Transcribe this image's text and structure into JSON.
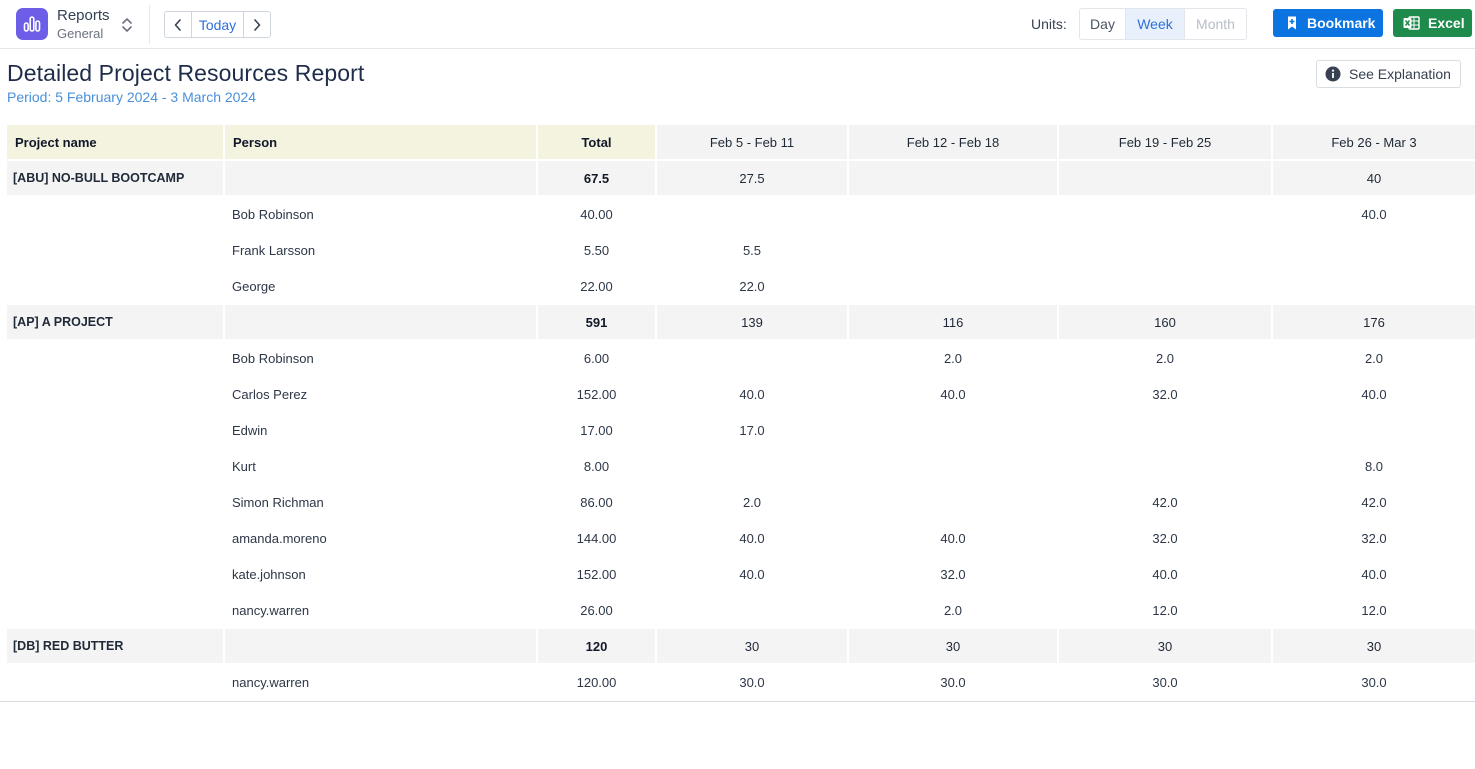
{
  "app": {
    "title": "Reports",
    "subtitle": "General"
  },
  "nav": {
    "today_label": "Today"
  },
  "units": {
    "label": "Units:",
    "options": [
      "Day",
      "Week",
      "Month"
    ],
    "selected": "Week"
  },
  "actions": {
    "bookmark_label": "Bookmark",
    "excel_label": "Excel",
    "explain_label": "See Explanation"
  },
  "colors": {
    "app_icon": "#6d5ee8",
    "bookmark": "#0b74e0",
    "excel": "#1e8a4c",
    "link": "#2f6fdb",
    "period": "#4a90d9"
  },
  "report": {
    "title": "Detailed Project Resources Report",
    "period": "Period: 5 February 2024 - 3 March 2024"
  },
  "table": {
    "columns": [
      "Project name",
      "Person",
      "Total",
      "Feb 5 - Feb 11",
      "Feb 12 - Feb 18",
      "Feb 19 - Feb 25",
      "Feb 26 - Mar 3"
    ],
    "projects": [
      {
        "name": "[ABU] NO-BULL BOOTCAMP",
        "total": "67.5",
        "weeks": [
          "27.5",
          "",
          "",
          "40"
        ],
        "people": [
          {
            "person": "Bob Robinson",
            "total": "40.00",
            "weeks": [
              "",
              "",
              "",
              "40.0"
            ]
          },
          {
            "person": "Frank Larsson",
            "total": "5.50",
            "weeks": [
              "5.5",
              "",
              "",
              ""
            ]
          },
          {
            "person": "George",
            "total": "22.00",
            "weeks": [
              "22.0",
              "",
              "",
              ""
            ]
          }
        ]
      },
      {
        "name": "[AP] A PROJECT",
        "total": "591",
        "weeks": [
          "139",
          "116",
          "160",
          "176"
        ],
        "people": [
          {
            "person": "Bob Robinson",
            "total": "6.00",
            "weeks": [
              "",
              "2.0",
              "2.0",
              "2.0"
            ]
          },
          {
            "person": "Carlos Perez",
            "total": "152.00",
            "weeks": [
              "40.0",
              "40.0",
              "32.0",
              "40.0"
            ]
          },
          {
            "person": "Edwin",
            "total": "17.00",
            "weeks": [
              "17.0",
              "",
              "",
              ""
            ]
          },
          {
            "person": "Kurt",
            "total": "8.00",
            "weeks": [
              "",
              "",
              "",
              "8.0"
            ]
          },
          {
            "person": "Simon Richman",
            "total": "86.00",
            "weeks": [
              "2.0",
              "",
              "42.0",
              "42.0"
            ]
          },
          {
            "person": "amanda.moreno",
            "total": "144.00",
            "weeks": [
              "40.0",
              "40.0",
              "32.0",
              "32.0"
            ]
          },
          {
            "person": "kate.johnson",
            "total": "152.00",
            "weeks": [
              "40.0",
              "32.0",
              "40.0",
              "40.0"
            ]
          },
          {
            "person": "nancy.warren",
            "total": "26.00",
            "weeks": [
              "",
              "2.0",
              "12.0",
              "12.0"
            ]
          }
        ]
      },
      {
        "name": "[DB] RED BUTTER",
        "total": "120",
        "weeks": [
          "30",
          "30",
          "30",
          "30"
        ],
        "people": [
          {
            "person": "nancy.warren",
            "total": "120.00",
            "weeks": [
              "30.0",
              "30.0",
              "30.0",
              "30.0"
            ]
          }
        ]
      }
    ]
  }
}
